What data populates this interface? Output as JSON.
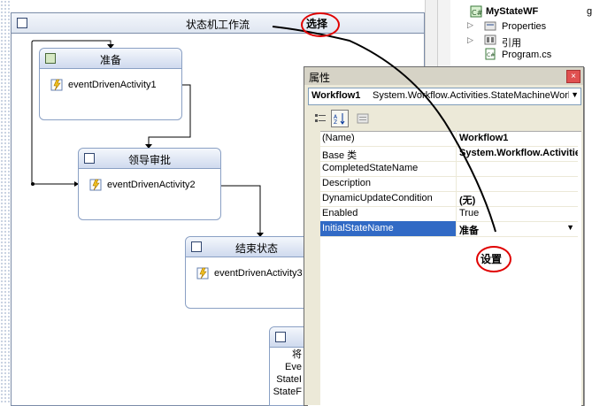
{
  "designer": {
    "title": "状态机工作流",
    "states": [
      {
        "title": "准备",
        "activities": [
          "eventDrivenActivity1"
        ]
      },
      {
        "title": "领导审批",
        "activities": [
          "eventDrivenActivity2"
        ]
      },
      {
        "title": "结束状态",
        "activities": [
          "eventDrivenActivity3"
        ]
      },
      {
        "title": "",
        "lines": [
          "将",
          "Eve",
          "StateI",
          "StateF"
        ]
      }
    ]
  },
  "callouts": {
    "select": "选择",
    "set": "设置",
    "color": "#e00000"
  },
  "solution_explorer": {
    "project": "MyStateWF",
    "items": [
      "Properties",
      "引用",
      "Program.cs"
    ],
    "clipped_text": "g"
  },
  "properties": {
    "title": "属性",
    "close_glyph": "×",
    "object_name": "Workflow1",
    "object_type": "System.Workflow.Activities.StateMachineWorkflowActivity",
    "rows": [
      {
        "name": "(Name)",
        "value": "Workflow1",
        "bold": true
      },
      {
        "name": "Base 类",
        "value": "System.Workflow.Activities.StateMachineWorkflowActivity",
        "bold": true
      },
      {
        "name": "CompletedStateName",
        "value": ""
      },
      {
        "name": "Description",
        "value": ""
      },
      {
        "name": "DynamicUpdateCondition",
        "value": "(无)",
        "bold": true
      },
      {
        "name": "Enabled",
        "value": "True"
      },
      {
        "name": "InitialStateName",
        "value": "准备",
        "bold": true,
        "selected": true
      }
    ]
  }
}
